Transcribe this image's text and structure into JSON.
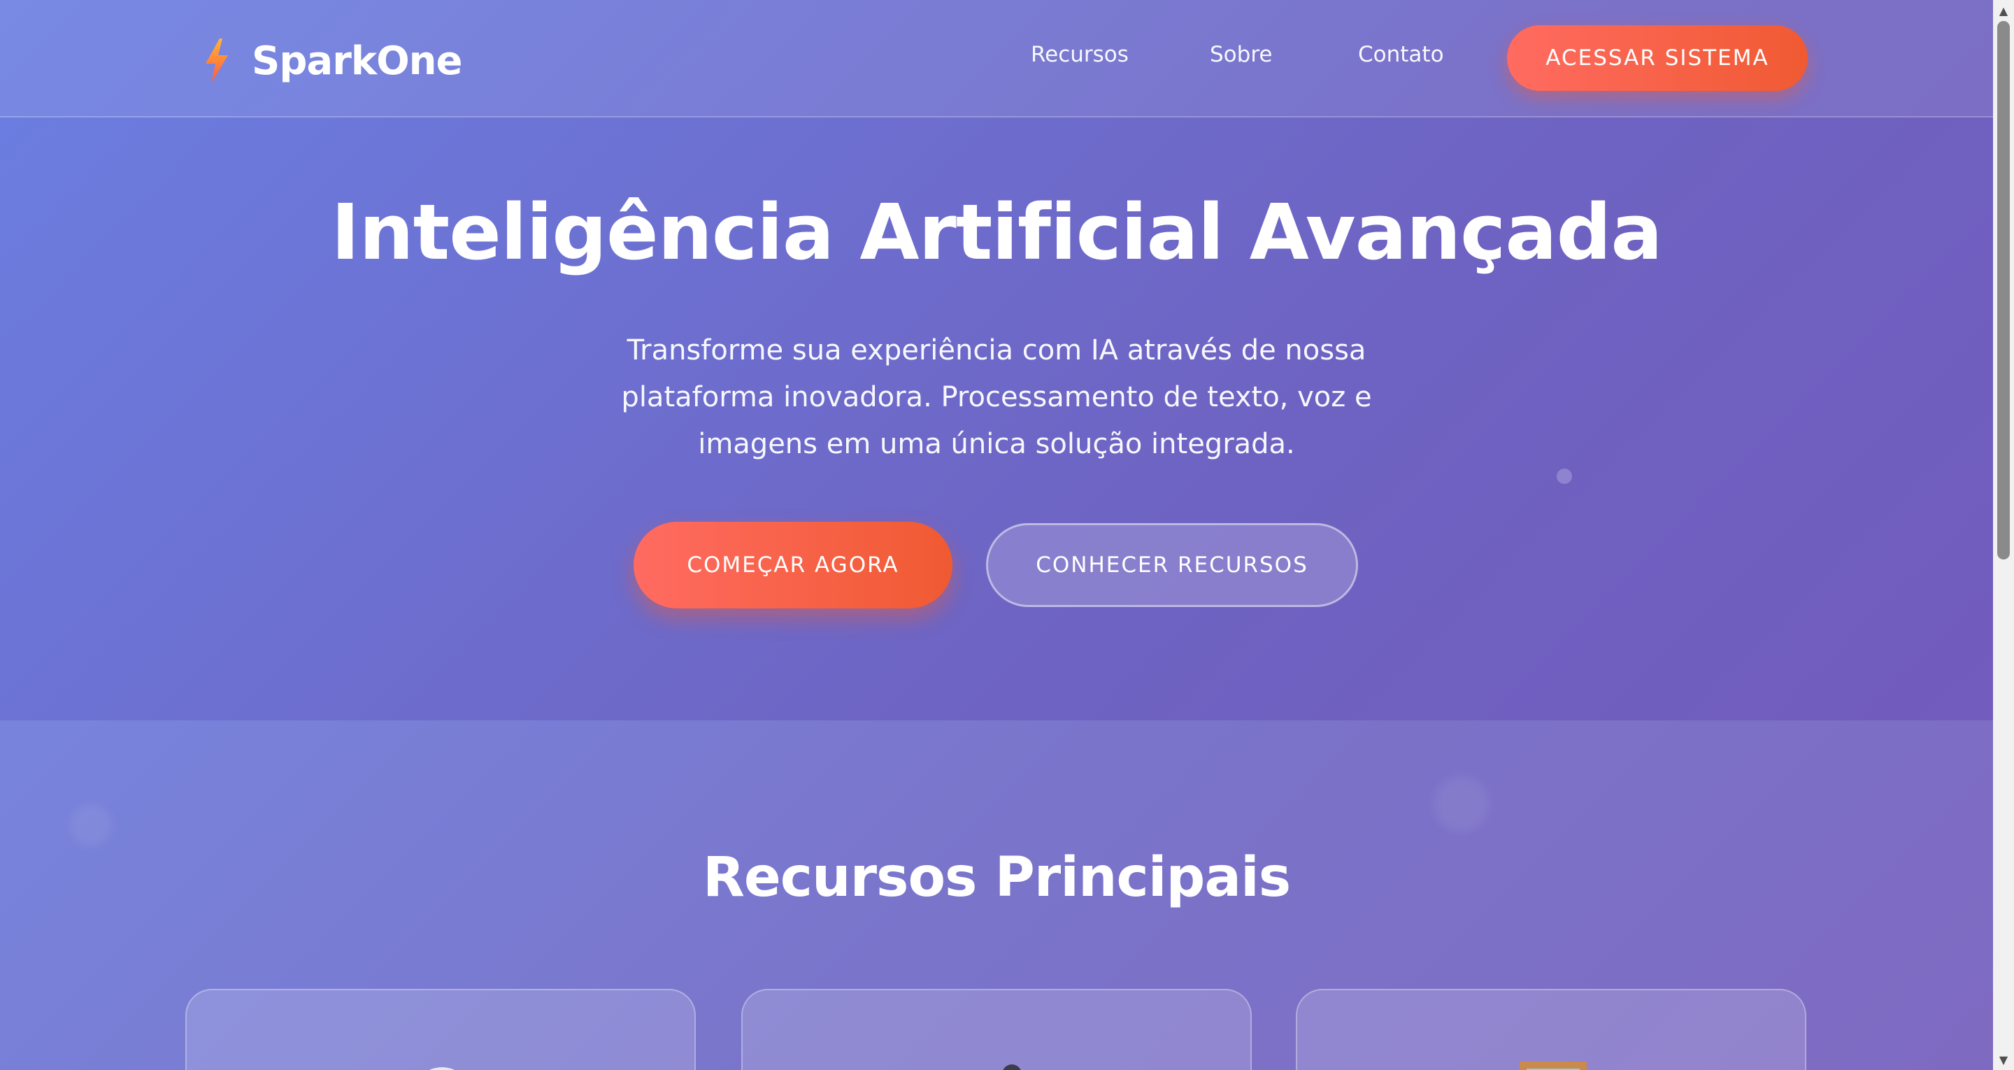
{
  "brand": {
    "name": "SparkOne",
    "logo_icon": "lightning-bolt-icon",
    "accent_gradient": [
      "#ff6b61",
      "#f05a32"
    ]
  },
  "nav": {
    "items": [
      {
        "label": "Recursos"
      },
      {
        "label": "Sobre"
      },
      {
        "label": "Contato"
      }
    ],
    "cta_label": "ACESSAR SISTEMA"
  },
  "hero": {
    "title": "Inteligência Artificial Avançada",
    "subtitle": "Transforme sua experiência com IA através de nossa plataforma inovadora. Processamento de texto, voz e imagens em uma única solução integrada.",
    "primary_button": "COMEÇAR AGORA",
    "secondary_button": "CONHECER RECURSOS"
  },
  "features": {
    "title": "Recursos Principais",
    "cards": [
      {
        "icon": "chat-bubble-icon"
      },
      {
        "icon": "microphone-icon"
      },
      {
        "icon": "image-frame-icon"
      }
    ]
  },
  "theme": {
    "background_gradient": [
      "#6b7fe2",
      "#7359bb"
    ]
  }
}
